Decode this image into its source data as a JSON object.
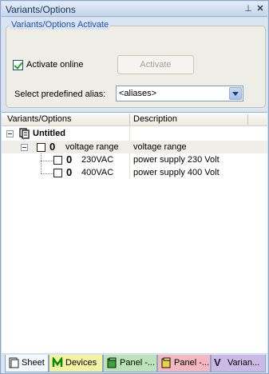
{
  "window": {
    "title": "Variants/Options",
    "pin_icon": "pin-icon",
    "close_icon": "close-icon"
  },
  "activate_group": {
    "title": "Variants/Options Activate",
    "activate_online_label": "Activate online",
    "activate_online_checked": true,
    "activate_button": "Activate",
    "alias_label": "Select predefined alias:",
    "alias_value": "<aliases>"
  },
  "tree": {
    "columns": [
      "Variants/Options",
      "Description"
    ],
    "rows": [
      {
        "label": "Untitled",
        "description": "",
        "icon": "document-icon",
        "level": 0
      },
      {
        "label": "voltage range",
        "description": "voltage range",
        "prefix": "0",
        "level": 1
      },
      {
        "label": "230VAC",
        "description": "power supply 230 Volt",
        "prefix": "0",
        "level": 2
      },
      {
        "label": "400VAC",
        "description": "power supply 400 Volt",
        "prefix": "0",
        "level": 2
      }
    ]
  },
  "tabs": [
    {
      "label": "Sheet",
      "icon": "sheet-icon",
      "color": "#dbe7f5"
    },
    {
      "label": "Devices",
      "icon": "devices-icon",
      "color": "#f4f3a3"
    },
    {
      "label": "Panel -...",
      "icon": "panel-icon",
      "color": "#bde3b8"
    },
    {
      "label": "Panel -...",
      "icon": "panel-icon",
      "color": "#f3b8c0"
    },
    {
      "label": "Varian...",
      "icon": "variants-icon",
      "color": "#cdb9e6",
      "active": true
    }
  ]
}
